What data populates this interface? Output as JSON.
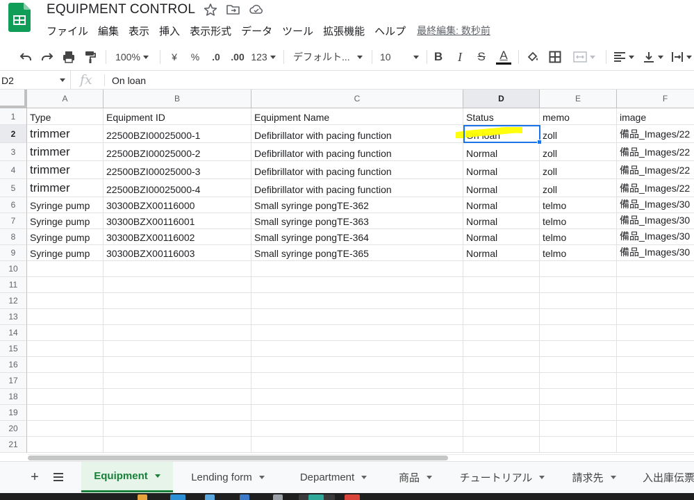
{
  "header": {
    "title": "EQUIPMENT CONTROL",
    "menu": [
      "ファイル",
      "編集",
      "表示",
      "挿入",
      "表示形式",
      "データ",
      "ツール",
      "拡張機能",
      "ヘルプ"
    ],
    "last_edit": "最終編集: 数秒前"
  },
  "toolbar": {
    "zoom": "100%",
    "currency": "¥",
    "percent": "%",
    "decrease_decimal": ".0",
    "increase_decimal": ".00",
    "number_format": "123",
    "font": "デフォルト...",
    "font_size": "10",
    "bold": "B",
    "italic": "I",
    "strike": "S",
    "text_color_glyph": "A"
  },
  "formula_bar": {
    "cell_ref": "D2",
    "fx": "fx",
    "content": "On loan"
  },
  "grid": {
    "columns": [
      "A",
      "B",
      "C",
      "D",
      "E",
      "F"
    ],
    "active_column": "D",
    "active_row": "2",
    "row_numbers": [
      "1",
      "2",
      "3",
      "4",
      "5",
      "6",
      "7",
      "8",
      "9",
      "10",
      "11",
      "12",
      "13",
      "14",
      "15",
      "16",
      "17",
      "18",
      "19",
      "20",
      "21"
    ],
    "rows": [
      [
        "Type",
        "Equipment ID",
        "Equipment Name",
        "Status",
        "memo",
        "image"
      ],
      [
        "trimmer",
        "22500BZI00025000-1",
        "Defibrillator with pacing function",
        "On loan",
        "zoll",
        "備品_Images/22"
      ],
      [
        "trimmer",
        "22500BZI00025000-2",
        "Defibrillator with pacing function",
        "Normal",
        "zoll",
        "備品_Images/22"
      ],
      [
        "trimmer",
        "22500BZI00025000-3",
        "Defibrillator with pacing function",
        "Normal",
        "zoll",
        "備品_Images/22"
      ],
      [
        "trimmer",
        "22500BZI00025000-4",
        "Defibrillator with pacing function",
        "Normal",
        "zoll",
        "備品_Images/22"
      ],
      [
        "Syringe pump",
        "30300BZX00116000",
        "Small syringe pongTE-362",
        "Normal",
        "telmo",
        "備品_Images/30"
      ],
      [
        "Syringe pump",
        "30300BZX00116001",
        "Small syringe pongTE-363",
        "Normal",
        "telmo",
        "備品_Images/30"
      ],
      [
        "Syringe pump",
        "30300BZX00116002",
        "Small syringe pongTE-364",
        "Normal",
        "telmo",
        "備品_Images/30"
      ],
      [
        "Syringe pump",
        "30300BZX00116003",
        "Small syringe pongTE-365",
        "Normal",
        "telmo",
        "備品_Images/30"
      ]
    ],
    "highlight_color": "#ffff00",
    "selection_color": "#1a73e8"
  },
  "sheets": {
    "add_label": "+",
    "tabs": [
      "Equipment",
      "Lending form",
      "Department",
      "商品",
      "チュートリアル",
      "請求先",
      "入出庫伝票"
    ],
    "active": "Equipment",
    "accent": "#188038"
  }
}
